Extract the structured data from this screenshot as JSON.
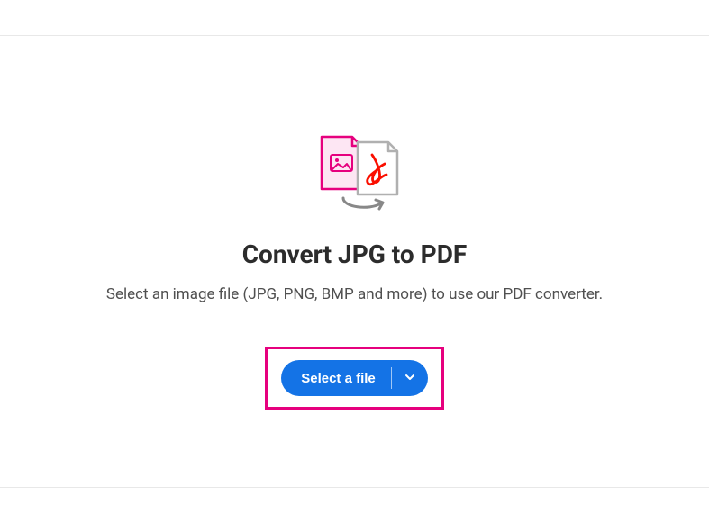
{
  "title": "Convert JPG to PDF",
  "subtitle": "Select an image file (JPG, PNG, BMP and more) to use our PDF converter.",
  "action": {
    "select_file_label": "Select a file"
  },
  "colors": {
    "accent_blue": "#1473e6",
    "accent_magenta": "#e6007e",
    "acrobat_red": "#fa0f00"
  }
}
